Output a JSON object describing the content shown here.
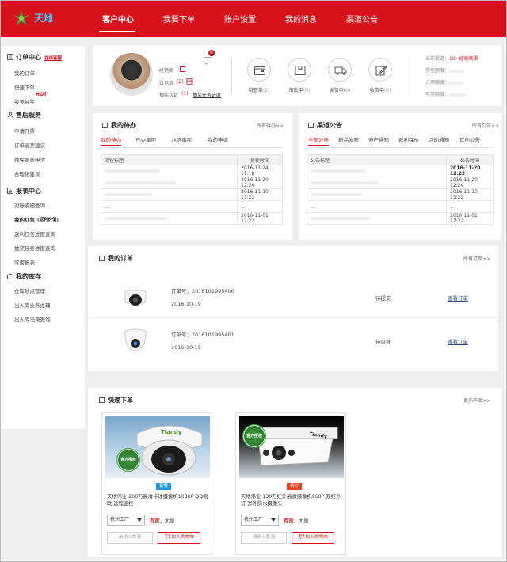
{
  "header": {
    "logo_text": "天地",
    "nav": [
      "客户中心",
      "我要下单",
      "账户设置",
      "我的消息",
      "渠道公告"
    ],
    "active": 0
  },
  "sidebar": {
    "groups": [
      {
        "title": "订单中心",
        "extra": "在线客服",
        "items": [
          "我的订单",
          "快速下单",
          "我要抽奖"
        ],
        "hot": "HOT"
      },
      {
        "title": "售后服务",
        "items": [
          "申请开票",
          "订单退货建议",
          "维保服务申请",
          "合理化建议"
        ]
      },
      {
        "title": "报表中心",
        "items": [
          "对账明细查询",
          "我的红包",
          "返利任务进度查询",
          "抽奖任务进度查询",
          "常用报表"
        ],
        "red_envelope_extra": "(返利价值)"
      },
      {
        "title": "我的库存",
        "items": [
          "仓库地点管理",
          "出入库业务办理",
          "出入库记录查询"
        ]
      }
    ]
  },
  "profile": {
    "labels": [
      "经销商",
      "红包数",
      "抽奖次数"
    ],
    "red_count": "(2)",
    "lottery_count": "(1)",
    "lottery_link": "抽奖任务进度",
    "bell_badge": "0",
    "quick": [
      {
        "label": "待签单",
        "count": "(2)"
      },
      {
        "label": "审批中",
        "count": "(0)"
      },
      {
        "label": "发货中",
        "count": "(0)"
      },
      {
        "label": "收货中",
        "count": "(0)"
      }
    ],
    "account": [
      {
        "label": "当前渠道：",
        "value": "10~经销商渠"
      },
      {
        "label": "授信额度：",
        "value": ""
      },
      {
        "label": "占用额度：",
        "value": ""
      },
      {
        "label": "可用额度：",
        "value": ""
      }
    ]
  },
  "todo": {
    "title": "我的待办",
    "more": "所有待办>>",
    "tabs": [
      "我的待办",
      "已办事项",
      "办结事项",
      "我的申请"
    ],
    "headers": [
      "流程标题",
      "更新时间"
    ],
    "rows": [
      {
        "title": "",
        "time": "2016-11-24 11:18"
      },
      {
        "title": "",
        "time": "2016-11-20 12:24"
      },
      {
        "title": "",
        "time": "2016-11-10 13:22"
      },
      {
        "title": "...",
        "time": "..."
      },
      {
        "title": "",
        "time": "2016-11-01 17:22"
      }
    ]
  },
  "notice": {
    "title": "渠道公告",
    "more": "所有公告>>",
    "tabs": [
      "全部公告",
      "新品发布",
      "停产通知",
      "返利保价",
      "活动通知",
      "其他公告"
    ],
    "headers": [
      "公告标题",
      "公告时间"
    ],
    "rows": [
      {
        "title": "",
        "time": "2016-11-20 12:22"
      },
      {
        "title": "",
        "time": "2016-11-20 12:24"
      },
      {
        "title": "",
        "time": "2016-11-10 13:22"
      },
      {
        "title": "...",
        "time": "..."
      },
      {
        "title": "",
        "time": "2016-11-01 17:22"
      }
    ]
  },
  "orders": {
    "title": "我的订单",
    "more": "所有订单>>",
    "list": [
      {
        "no": "订单号：2016101995400",
        "date": "2016-10-19",
        "status": "待提交",
        "action": "查看订单"
      },
      {
        "no": "订单号：2016101995401",
        "date": "2016-10-19",
        "status": "待审批",
        "action": "查看订单"
      }
    ]
  },
  "quick_order": {
    "title": "快速下单",
    "more": "更多产品>>",
    "products": [
      {
        "badge": "套餐",
        "badge_color": "#2196d8",
        "name": "天地伟业 200万高清半球摄像机1080P QQ物联 远程监控",
        "warehouse": "杭州工厂",
        "stock_a": "有货，",
        "stock_b": "大量",
        "qty_placeholder": "请输入数量",
        "cart": "加入购物车",
        "seal": "官方授权"
      },
      {
        "badge": "特价",
        "badge_color": "#e8431f",
        "name": "天地伟业 130万红外高清摄像机960P 双红外灯 室外防水摄像头",
        "warehouse": "杭州工厂",
        "stock_a": "有货，",
        "stock_b": "大量",
        "qty_placeholder": "请输入数量",
        "cart": "加入购物车",
        "seal": "官方授权"
      }
    ]
  },
  "colors": {
    "brand": "#d7121b",
    "link": "#2a4a8a"
  }
}
